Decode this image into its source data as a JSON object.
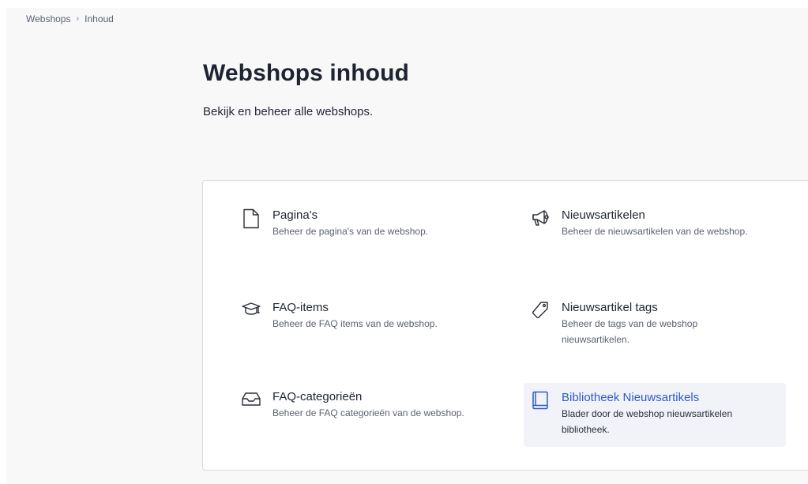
{
  "breadcrumb": {
    "items": [
      "Webshops",
      "Inhoud"
    ],
    "separator": "›"
  },
  "header": {
    "title": "Webshops inhoud",
    "subtitle": "Bekijk en beheer alle webshops."
  },
  "menu": {
    "items": [
      {
        "label": "Pagina's",
        "description": "Beheer de pagina's van de webshop.",
        "icon": "document-icon"
      },
      {
        "label": "Nieuwsartikelen",
        "description": "Beheer de nieuwsartikelen van de webshop.",
        "icon": "megaphone-icon"
      },
      {
        "label": "FAQ-items",
        "description": "Beheer de FAQ items van de webshop.",
        "icon": "graduation-cap-icon"
      },
      {
        "label": "Nieuwsartikel tags",
        "description": "Beheer de tags van de webshop nieuwsartikelen.",
        "icon": "tag-icon"
      },
      {
        "label": "FAQ-categorieën",
        "description": "Beheer de FAQ categorieën van de webshop.",
        "icon": "inbox-tray-icon"
      },
      {
        "label": "Bibliotheek Nieuwsartikels",
        "description": "Blader door de webshop nieuwsartikelen bibliotheek.",
        "icon": "book-icon",
        "active": true
      }
    ]
  },
  "colors": {
    "accent": "#2c5cc5",
    "active_bg": "#f1f3f9",
    "page_bg": "#f8f8f9",
    "card_border": "#d7d9de"
  }
}
